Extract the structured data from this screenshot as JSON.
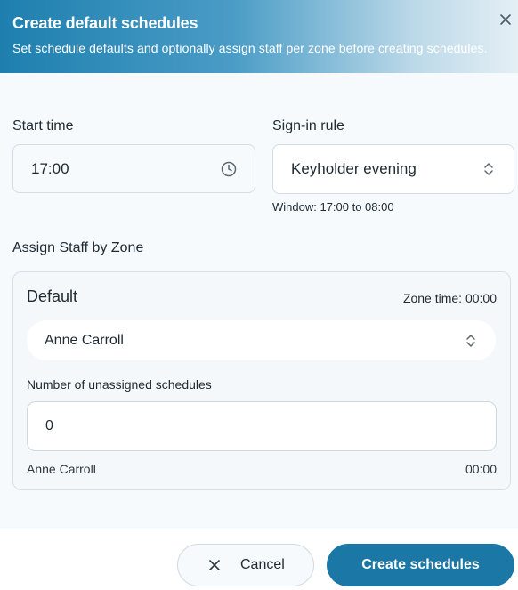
{
  "dialog": {
    "title": "Create default schedules",
    "subtitle": "Set schedule defaults and optionally assign staff per zone before creating schedules."
  },
  "start_time": {
    "label": "Start time",
    "value": "17:00",
    "icon": "clock-icon"
  },
  "sign_in_rule": {
    "label": "Sign-in rule",
    "value": "Keyholder evening",
    "hint": "Window: 17:00 to 08:00",
    "icon": "chevron-updown-icon"
  },
  "assign_section": {
    "title": "Assign Staff by Zone"
  },
  "zone": {
    "name": "Default",
    "zone_time": "Zone time: 00:00",
    "staff_value": "Anne Carroll",
    "unassigned_label": "Number of unassigned schedules",
    "unassigned_value": "0",
    "footer_name": "Anne Carroll",
    "footer_time": "00:00"
  },
  "actions": {
    "cancel_label": "Cancel",
    "create_label": "Create schedules"
  },
  "colors": {
    "primary": "#1b78a6",
    "header_start": "#1e7fae"
  }
}
